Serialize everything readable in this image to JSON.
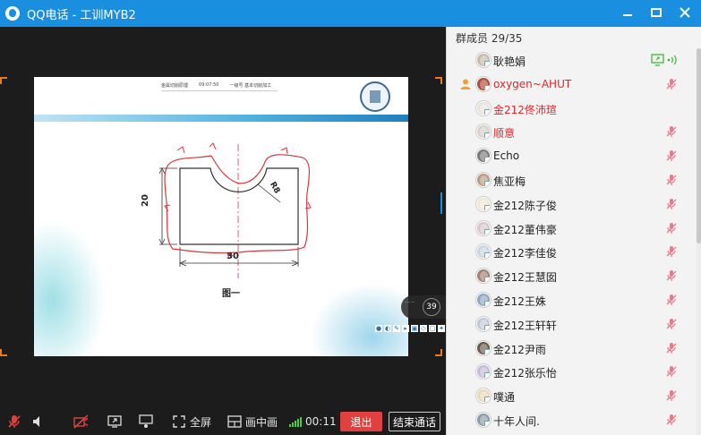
{
  "window": {
    "title": "QQ电话 - 工训MYB2"
  },
  "slide": {
    "header_text_1": "金属切削原理",
    "header_text_2": "09:07:50",
    "header_text_3": "一级号 基本切削加工",
    "dimension_20": "20",
    "dimension_30": "30",
    "dimension_r8": "R8",
    "figure_label": "图一",
    "page_number": "39",
    "page_badge_text": "·········"
  },
  "toolbar": {
    "fullscreen_label": "全屏",
    "pip_label": "画中画",
    "call_timer": "00:11",
    "exit_label": "退出",
    "end_call_label": "结束通话"
  },
  "members": {
    "header": "群成员 29/35",
    "list": [
      {
        "name": "耿艳娟",
        "highlight": false,
        "host": false,
        "mic": "screen-share"
      },
      {
        "name": "oxygen~AHUT",
        "highlight": true,
        "host": true,
        "mic": "muted"
      },
      {
        "name": "金212佟沛瑄",
        "highlight": true,
        "host": false,
        "mic": "none"
      },
      {
        "name": "顺意",
        "highlight": true,
        "host": false,
        "mic": "muted"
      },
      {
        "name": "Echo",
        "highlight": false,
        "host": false,
        "mic": "muted"
      },
      {
        "name": "焦亚梅",
        "highlight": false,
        "host": false,
        "mic": "muted"
      },
      {
        "name": "金212陈子俊",
        "highlight": false,
        "host": false,
        "mic": "muted"
      },
      {
        "name": "金212董伟豪",
        "highlight": false,
        "host": false,
        "mic": "muted"
      },
      {
        "name": "金212李佳俊",
        "highlight": false,
        "host": false,
        "mic": "muted"
      },
      {
        "name": "金212王慧囡",
        "highlight": false,
        "host": false,
        "mic": "muted"
      },
      {
        "name": "金212王姝",
        "highlight": false,
        "host": false,
        "mic": "muted"
      },
      {
        "name": "金212王轩轩",
        "highlight": false,
        "host": false,
        "mic": "muted"
      },
      {
        "name": "金212尹雨",
        "highlight": false,
        "host": false,
        "mic": "muted"
      },
      {
        "name": "金212张乐怡",
        "highlight": false,
        "host": false,
        "mic": "muted"
      },
      {
        "name": "噗通",
        "highlight": false,
        "host": false,
        "mic": "muted"
      },
      {
        "name": "十年人间.",
        "highlight": false,
        "host": false,
        "mic": "muted"
      }
    ]
  },
  "colors": {
    "titlebar": "#1a8fe0",
    "highlight_name": "#e0262b",
    "exit_button": "#e04040",
    "sketch_red": "#d9363e"
  }
}
